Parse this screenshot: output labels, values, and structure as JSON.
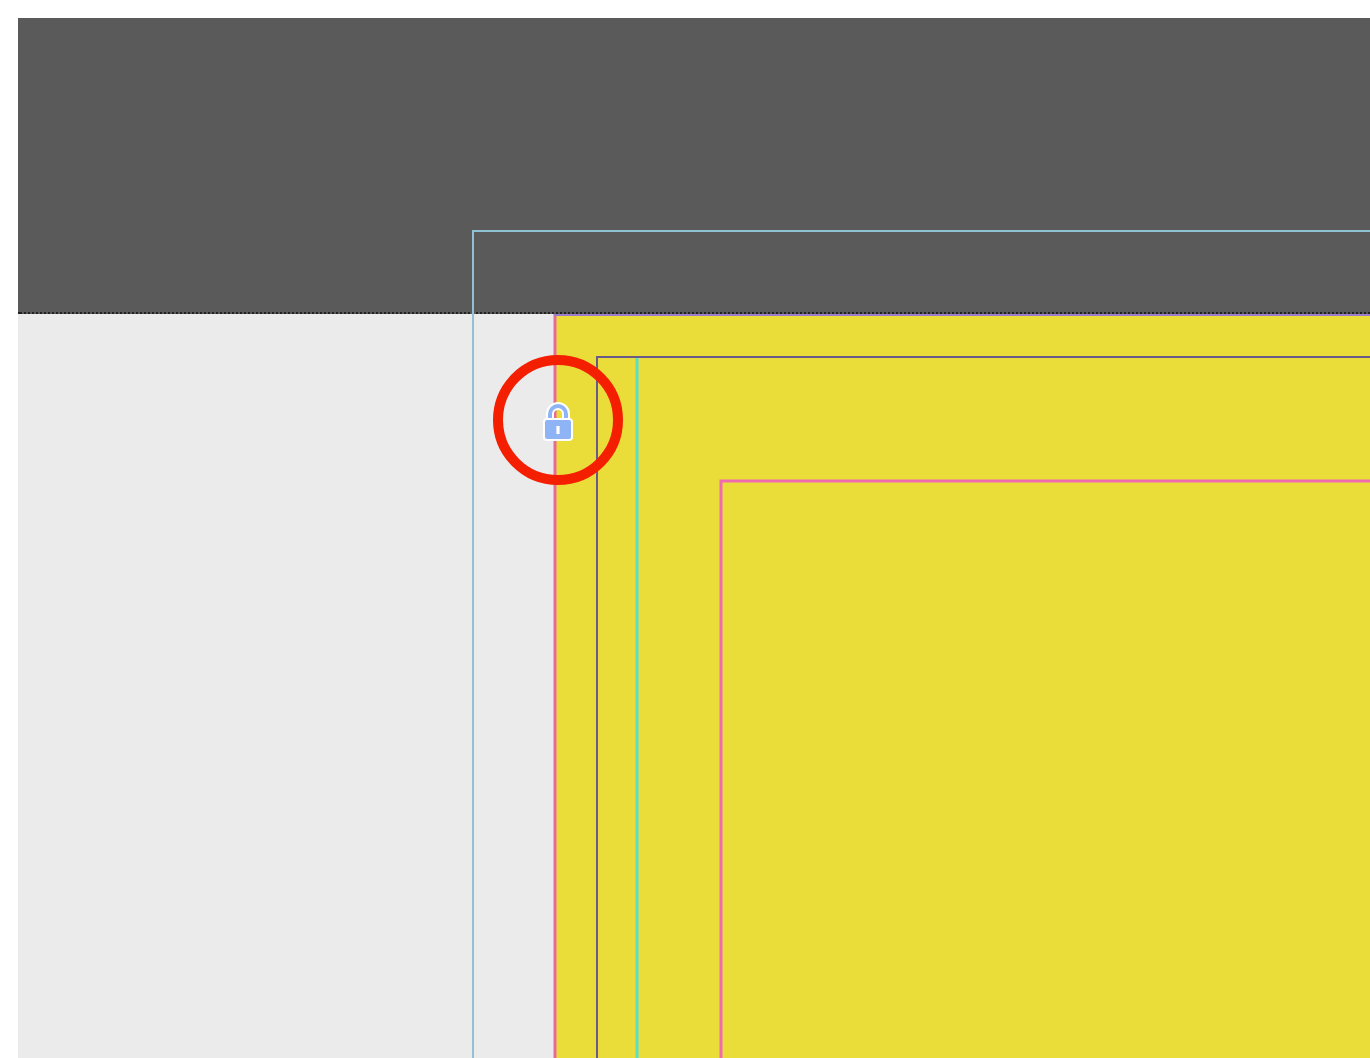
{
  "canvas": {
    "locked": true,
    "callout": {
      "highlighted": true
    }
  }
}
